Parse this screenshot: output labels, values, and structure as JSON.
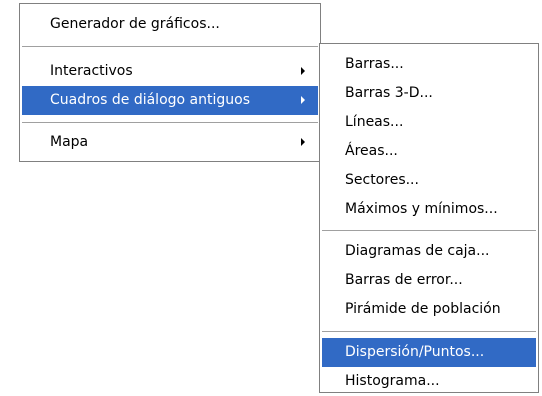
{
  "main_menu": {
    "items": [
      {
        "label": "Generador de gráficos..."
      },
      {
        "label": "Interactivos"
      },
      {
        "label": "Cuadros de diálogo antiguos"
      },
      {
        "label": "Mapa"
      }
    ]
  },
  "sub_menu": {
    "items": [
      {
        "label": "Barras..."
      },
      {
        "label": "Barras 3-D..."
      },
      {
        "label": "Líneas..."
      },
      {
        "label": "Áreas..."
      },
      {
        "label": "Sectores..."
      },
      {
        "label": "Máximos y mínimos..."
      },
      {
        "label": "Diagramas de caja..."
      },
      {
        "label": "Barras de error..."
      },
      {
        "label": "Pirámide de población"
      },
      {
        "label": "Dispersión/Puntos..."
      },
      {
        "label": "Histograma..."
      }
    ]
  },
  "colors": {
    "highlight": "#316ac5",
    "highlight_text": "#ffffff",
    "border": "#808080"
  }
}
